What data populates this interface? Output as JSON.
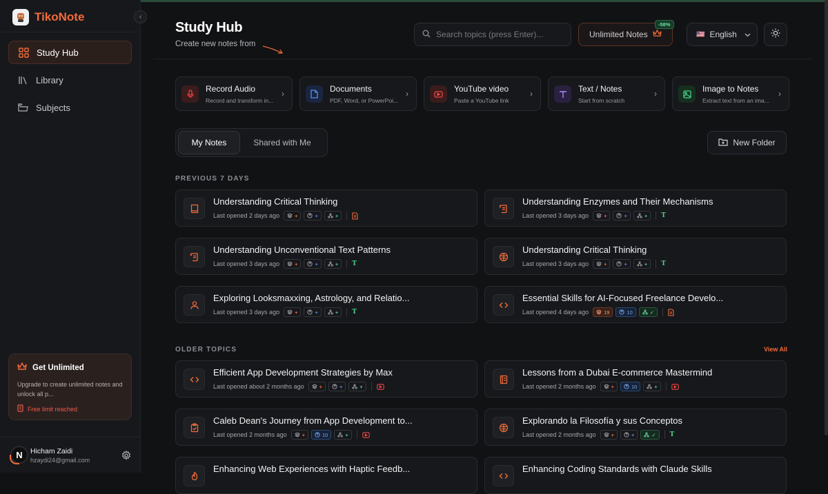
{
  "app": {
    "name": "TikoNote"
  },
  "nav": [
    {
      "label": "Study Hub",
      "icon": "grid-icon",
      "active": true
    },
    {
      "label": "Library",
      "icon": "library-icon",
      "active": false
    },
    {
      "label": "Subjects",
      "icon": "folder-icon",
      "active": false
    }
  ],
  "upgrade": {
    "title": "Get Unlimited",
    "desc": "Upgrade to create unlimited notes and unlock all p...",
    "limit": "Free limit reached"
  },
  "user": {
    "name": "Hicham Zaidi",
    "email": "hzaydi24@gmail.com",
    "initial": "N"
  },
  "header": {
    "title": "Study Hub",
    "subtitle": "Create new notes from"
  },
  "search": {
    "placeholder": "Search topics (press Enter)..."
  },
  "unlimited": {
    "label": "Unlimited Notes",
    "discount": "-58%"
  },
  "language": {
    "label": "English",
    "flag": "🇺🇸"
  },
  "actions": [
    {
      "title": "Record Audio",
      "sub": "Record and transform in...",
      "icon": "mic-icon",
      "color": "#ef4444",
      "bg": "#3a1c1c"
    },
    {
      "title": "Documents",
      "sub": "PDF, Word, or PowerPoi...",
      "icon": "document-icon",
      "color": "#5b8ef0",
      "bg": "#1a2540"
    },
    {
      "title": "YouTube video",
      "sub": "Paste a YouTube link",
      "icon": "youtube-icon",
      "color": "#ef4444",
      "bg": "#3a1c1c"
    },
    {
      "title": "Text / Notes",
      "sub": "Start from scratch",
      "icon": "text-icon",
      "color": "#a78bfa",
      "bg": "#2a2140"
    },
    {
      "title": "Image to Notes",
      "sub": "Extract text from an ima...",
      "icon": "image-icon",
      "color": "#4bd28a",
      "bg": "#16301f"
    }
  ],
  "tabs": {
    "my_notes": "My Notes",
    "shared": "Shared with Me"
  },
  "new_folder": "New Folder",
  "sections": {
    "recent": "PREVIOUS 7 DAYS",
    "older": "OLDER TOPICS",
    "view_all": "View All"
  },
  "recent_notes": [
    {
      "title": "Understanding Critical Thinking",
      "date": "Last opened 2 days ago",
      "icon": "book-icon",
      "flash": "+",
      "quiz": "+",
      "mind": "+",
      "src": "document"
    },
    {
      "title": "Understanding Enzymes and Their Mechanisms",
      "date": "Last opened 3 days ago",
      "icon": "scroll-icon",
      "flash": "+",
      "quiz": "+",
      "mind": "+",
      "src": "text"
    },
    {
      "title": "Understanding Unconventional Text Patterns",
      "date": "Last opened 3 days ago",
      "icon": "scroll-icon",
      "flash": "+",
      "quiz": "+",
      "mind": "+",
      "src": "text"
    },
    {
      "title": "Understanding Critical Thinking",
      "date": "Last opened 3 days ago",
      "icon": "brain-icon",
      "flash": "+",
      "quiz": "+",
      "mind": "+",
      "src": "text"
    },
    {
      "title": "Exploring Looksmaxxing, Astrology, and Relatio...",
      "date": "Last opened 3 days ago",
      "icon": "person-icon",
      "flash": "+",
      "quiz": "+",
      "mind": "+",
      "src": "text"
    },
    {
      "title": "Essential Skills for AI-Focused Freelance Develo...",
      "date": "Last opened 4 days ago",
      "icon": "code-icon",
      "flash": "19",
      "quiz": "10",
      "mind": "✓",
      "src": "document"
    }
  ],
  "older_notes": [
    {
      "title": "Efficient App Development Strategies by Max",
      "date": "Last opened about 2 months ago",
      "icon": "code-icon",
      "flash": "+",
      "quiz": "+",
      "mind": "+",
      "src": "youtube"
    },
    {
      "title": "Lessons from a Dubai E-commerce Mastermind",
      "date": "Last opened 2 months ago",
      "icon": "notebook-icon",
      "flash": "+",
      "quiz": "10",
      "mind": "+",
      "src": "youtube"
    },
    {
      "title": "Caleb Dean's Journey from App Development to...",
      "date": "Last opened 2 months ago",
      "icon": "clipboard-icon",
      "flash": "+",
      "quiz": "10",
      "mind": "+",
      "src": "youtube"
    },
    {
      "title": "Explorando la Filosofía y sus Conceptos",
      "date": "Last opened 2 months ago",
      "icon": "brain-icon",
      "flash": "+",
      "quiz": "+",
      "mind": "✓",
      "src": "text"
    },
    {
      "title": "Enhancing Web Experiences with Haptic Feedb...",
      "date": "",
      "icon": "flame-icon",
      "flash": "+",
      "quiz": "+",
      "mind": "+",
      "src": ""
    },
    {
      "title": "Enhancing Coding Standards with Claude Skills",
      "date": "",
      "icon": "code-icon",
      "flash": "+",
      "quiz": "+",
      "mind": "+",
      "src": ""
    }
  ]
}
